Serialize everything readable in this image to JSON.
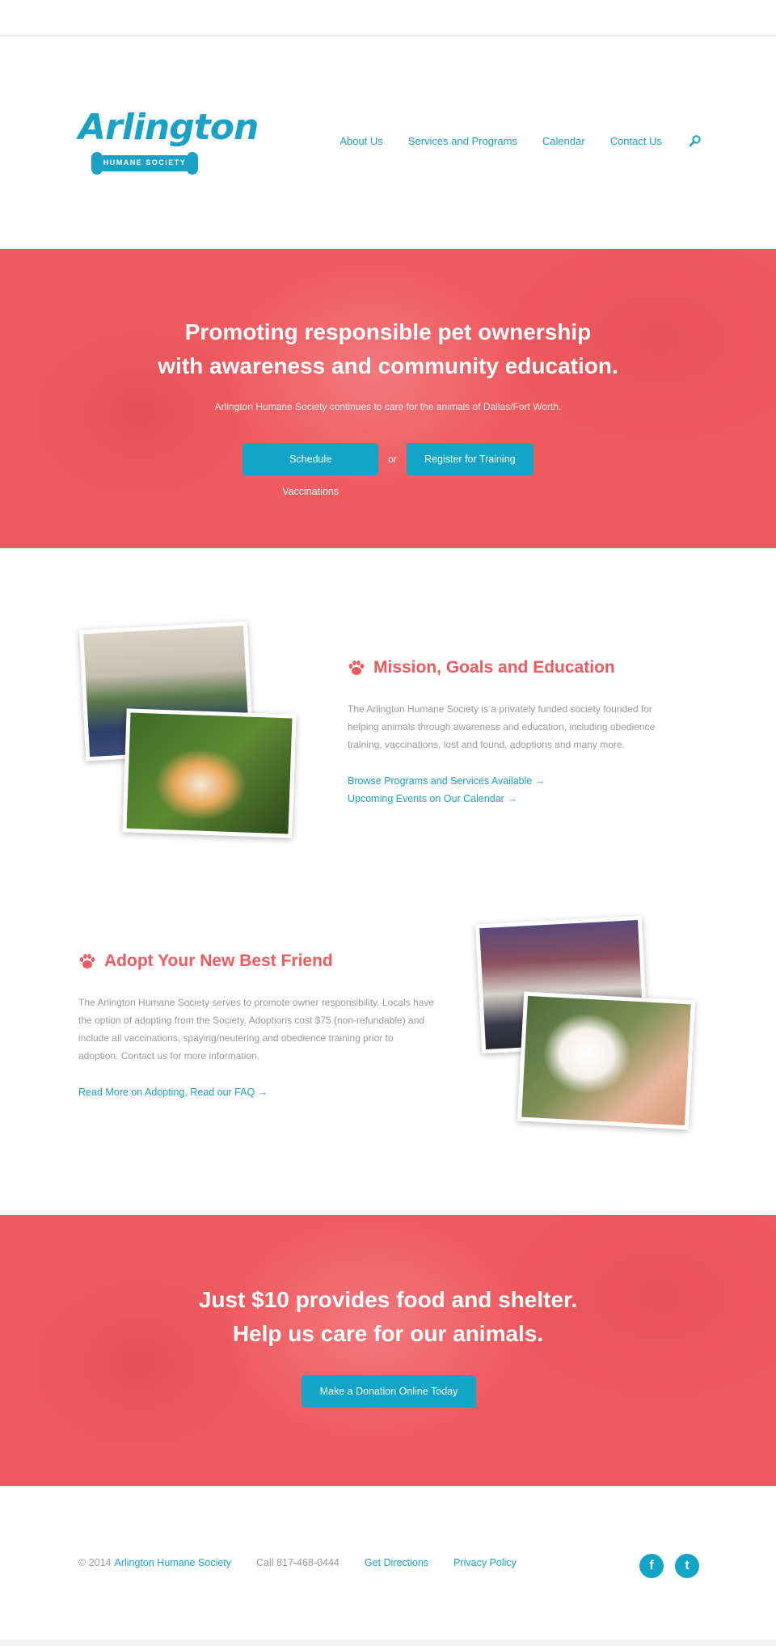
{
  "header": {
    "logo_text": "Arlington",
    "logo_subtext": "HUMANE SOCIETY",
    "nav": [
      {
        "label": "About Us"
      },
      {
        "label": "Services and Programs"
      },
      {
        "label": "Calendar"
      },
      {
        "label": "Contact Us"
      }
    ]
  },
  "hero": {
    "title_line1": "Promoting responsible pet ownership",
    "title_line2": "with awareness and community education.",
    "subtitle": "Arlington Humane Society continues to care for the animals of Dallas/Fort Worth.",
    "button_primary": "Schedule Vaccinations",
    "or_text": "or",
    "button_secondary": "Register for Training"
  },
  "mission": {
    "title": "Mission, Goals and Education",
    "body": "The Arlington Humane Society is a privately funded society founded for helping animals through awareness and education, including obedience training, vaccinations, lost and found, adoptions and many more.",
    "link1": "Browse Programs and Services Available →",
    "link2": "Upcoming Events on Our Calendar →"
  },
  "adopt": {
    "title": "Adopt Your New Best Friend",
    "body": "The Arlington Humane Society serves to promote owner responsibility. Locals have the option of adopting from the Society. Adoptions cost $75 (non-refundable) and include all vaccinations, spaying/neutering and obedience training prior to adoption. Contact us for more information.",
    "link": "Read More on Adopting, Read our FAQ →"
  },
  "cta": {
    "title_line1": "Just $10 provides food and shelter.",
    "title_line2": "Help us care for our animals.",
    "button": "Make a Donation Online Today"
  },
  "footer": {
    "copyright_prefix": "© 2014",
    "org_name": "Arlington Humane Society",
    "phone": "Call 817-468-0444",
    "directions": "Get Directions",
    "privacy": "Privacy Policy",
    "facebook_glyph": "f",
    "twitter_glyph": "t"
  },
  "colors": {
    "brand_blue": "#1aa1c6",
    "brand_red": "#ef5a5f",
    "button_blue": "#12a5c8"
  },
  "icons": [
    "search-icon",
    "paw-icon",
    "facebook-icon",
    "twitter-icon"
  ]
}
